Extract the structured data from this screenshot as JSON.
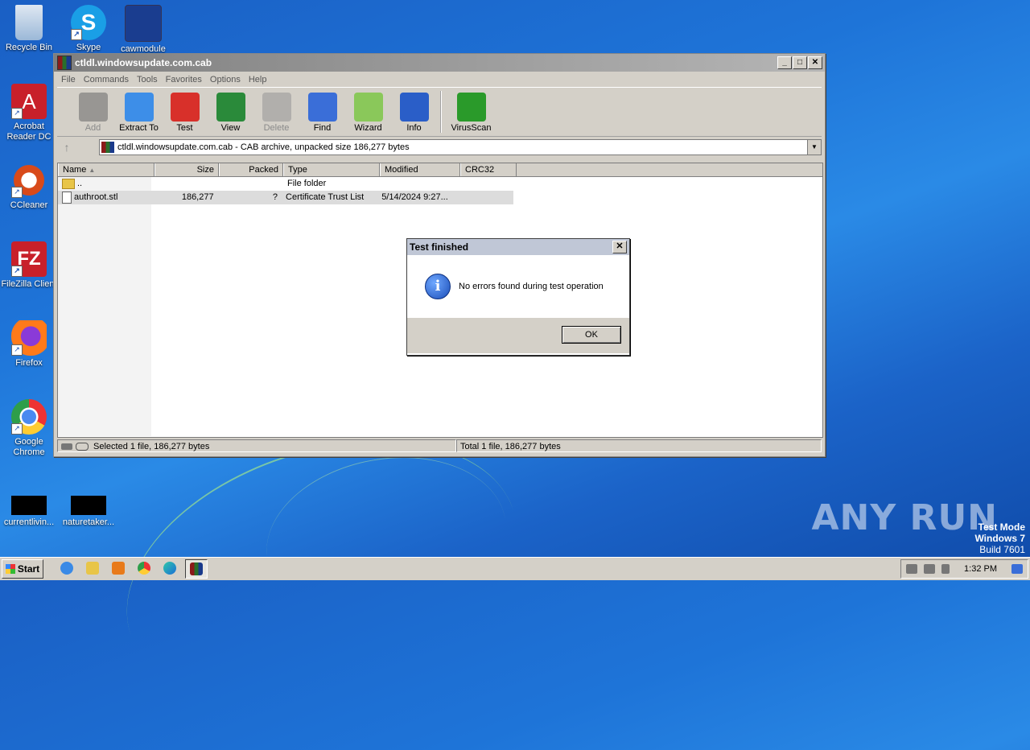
{
  "desktop": {
    "icons": [
      {
        "label": "Recycle Bin",
        "color": "#9bb8d8"
      },
      {
        "label": "Skype",
        "color": "#1a9fe6"
      },
      {
        "label": "cawmodule",
        "color": "#1a3d8f"
      },
      {
        "label": "Acrobat Reader DC",
        "color": "#c8202a"
      },
      {
        "label": "CCleaner",
        "color": "#d84a1a"
      },
      {
        "label": "FileZilla Client",
        "color": "#c8202a"
      },
      {
        "label": "Firefox",
        "color": "#ff7a1a"
      },
      {
        "label": "Google Chrome",
        "color": "#2e9e4a"
      },
      {
        "label": "currentlivin...",
        "color": "#000000"
      },
      {
        "label": "naturetaker...",
        "color": "#000000"
      }
    ]
  },
  "window": {
    "title": "ctldl.windowsupdate.com.cab",
    "menu": [
      "File",
      "Commands",
      "Tools",
      "Favorites",
      "Options",
      "Help"
    ],
    "toolbar": [
      {
        "label": "Add",
        "icon": "add-archive-icon",
        "disabled": true,
        "color": "#707070"
      },
      {
        "label": "Extract To",
        "icon": "extract-folder-icon",
        "disabled": false,
        "color": "#3d8ee8"
      },
      {
        "label": "Test",
        "icon": "test-checklist-icon",
        "disabled": false,
        "color": "#d8302a"
      },
      {
        "label": "View",
        "icon": "view-book-icon",
        "disabled": false,
        "color": "#2a8a3a"
      },
      {
        "label": "Delete",
        "icon": "trash-icon",
        "disabled": true,
        "color": "#9a9a9a"
      },
      {
        "label": "Find",
        "icon": "magnifier-icon",
        "disabled": false,
        "color": "#3a6ed8"
      },
      {
        "label": "Wizard",
        "icon": "wand-icon",
        "disabled": false,
        "color": "#8ac85a"
      },
      {
        "label": "Info",
        "icon": "info-icon",
        "disabled": false,
        "color": "#2a5ec8"
      },
      {
        "label": "VirusScan",
        "icon": "bug-icon",
        "disabled": false,
        "color": "#2a9a2a"
      }
    ],
    "address": "ctldl.windowsupdate.com.cab - CAB archive, unpacked size 186,277 bytes",
    "columns": [
      "Name",
      "Size",
      "Packed",
      "Type",
      "Modified",
      "CRC32"
    ],
    "rows": [
      {
        "name": "..",
        "size": "",
        "packed": "",
        "type": "File folder",
        "modified": "",
        "crc": ""
      },
      {
        "name": "authroot.stl",
        "size": "186,277",
        "packed": "?",
        "type": "Certificate Trust List",
        "modified": "5/14/2024 9:27...",
        "crc": ""
      }
    ],
    "status_left": "Selected 1 file, 186,277 bytes",
    "status_right": "Total 1 file, 186,277 bytes"
  },
  "dialog": {
    "title": "Test finished",
    "message": "No errors found during test operation",
    "ok_label": "OK"
  },
  "taskbar": {
    "start_label": "Start",
    "clock": "1:32 PM"
  },
  "watermark": "ANY RUN",
  "test_mode": {
    "line1": "Test Mode",
    "line2": "Windows 7",
    "line3": "Build 7601"
  }
}
